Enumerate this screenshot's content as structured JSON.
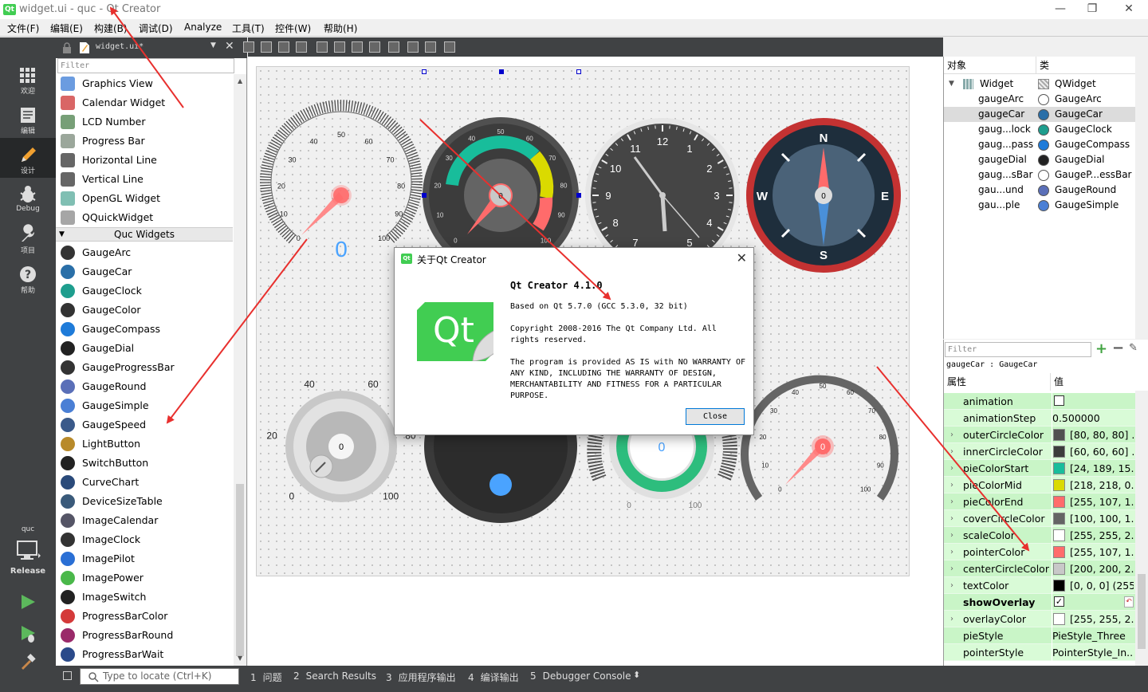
{
  "window": {
    "title": "widget.ui - quc - Qt Creator",
    "minimize": "—",
    "restore": "❐",
    "close": "✕"
  },
  "menu": [
    "文件(F)",
    "编辑(E)",
    "构建(B)",
    "调试(D)",
    "Analyze",
    "工具(T)",
    "控件(W)",
    "帮助(H)"
  ],
  "modes": [
    {
      "label": "欢迎",
      "icon": "grid-icon"
    },
    {
      "label": "编辑",
      "icon": "edit-icon"
    },
    {
      "label": "设计",
      "icon": "pencil-icon"
    },
    {
      "label": "Debug",
      "icon": "bug-icon"
    },
    {
      "label": "项目",
      "icon": "wrench-icon"
    },
    {
      "label": "帮助",
      "icon": "help-icon"
    }
  ],
  "kit": {
    "project": "quc",
    "config": "Release"
  },
  "editor_tab": {
    "filename": "widget.ui*"
  },
  "widget_box": {
    "filter_placeholder": "Filter",
    "items_top": [
      "Graphics View",
      "Calendar Widget",
      "LCD Number",
      "Progress Bar",
      "Horizontal Line",
      "Vertical Line",
      "OpenGL Widget",
      "QQuickWidget"
    ],
    "category": "Quc Widgets",
    "items_quc": [
      "GaugeArc",
      "GaugeCar",
      "GaugeClock",
      "GaugeColor",
      "GaugeCompass",
      "GaugeDial",
      "GaugeProgressBar",
      "GaugeRound",
      "GaugeSimple",
      "GaugeSpeed",
      "LightButton",
      "SwitchButton",
      "CurveChart",
      "DeviceSizeTable",
      "ImageCalendar",
      "ImageClock",
      "ImagePilot",
      "ImagePower",
      "ImageSwitch",
      "ProgressBarColor",
      "ProgressBarRound",
      "ProgressBarWait"
    ]
  },
  "canvas": {
    "gauge_arc": {
      "ticks": [
        "0",
        "10",
        "20",
        "30",
        "40",
        "50",
        "60",
        "70",
        "80",
        "90",
        "100"
      ],
      "value": "0"
    },
    "gauge_car": {
      "ticks": [
        "0",
        "10",
        "20",
        "30",
        "40",
        "50",
        "60",
        "70",
        "80",
        "90",
        "100"
      ],
      "value": "0"
    },
    "gauge_clock": {
      "ticks": [
        "12",
        "1",
        "2",
        "3",
        "4",
        "5",
        "7",
        "8",
        "9",
        "10",
        "11"
      ]
    },
    "gauge_compass": {
      "n": "N",
      "e": "E",
      "s": "S",
      "w": "W",
      "value": "0"
    },
    "gauge_dial": {
      "ticks": [
        "0",
        "20",
        "40",
        "60",
        "80",
        "100"
      ],
      "value": "0"
    },
    "gauge_round": {
      "value": "0",
      "min": "0",
      "max": "100"
    },
    "gauge_simple": {
      "ticks": [
        "0",
        "10",
        "20",
        "30",
        "40",
        "50",
        "60",
        "70",
        "80",
        "90",
        "100"
      ],
      "value": "0"
    }
  },
  "about_dialog": {
    "title": "关于Qt Creator",
    "heading": "Qt Creator 4.1.0",
    "based_on": "Based on Qt 5.7.0 (GCC 5.3.0, 32 bit)",
    "copyright": "Copyright 2008-2016 The Qt Company Ltd. All rights reserved.",
    "warranty": "The program is provided AS IS with NO WARRANTY OF ANY KIND, INCLUDING THE WARRANTY OF DESIGN, MERCHANTABILITY AND FITNESS FOR A PARTICULAR PURPOSE.",
    "logo_text": "Qt",
    "close_button": "Close"
  },
  "object_inspector": {
    "col_object": "对象",
    "col_class": "类",
    "root": {
      "name": "Widget",
      "cls": "QWidget"
    },
    "rows": [
      {
        "name": "gaugeArc",
        "cls": "GaugeArc"
      },
      {
        "name": "gaugeCar",
        "cls": "GaugeCar"
      },
      {
        "name": "gaug...lock",
        "cls": "GaugeClock"
      },
      {
        "name": "gaug...pass",
        "cls": "GaugeCompass"
      },
      {
        "name": "gaugeDial",
        "cls": "GaugeDial"
      },
      {
        "name": "gaug...sBar",
        "cls": "GaugeP...essBar"
      },
      {
        "name": "gau...und",
        "cls": "GaugeRound"
      },
      {
        "name": "gau...ple",
        "cls": "GaugeSimple"
      }
    ],
    "selected_index": 1
  },
  "property_editor": {
    "filter_placeholder": "Filter",
    "object_class": "gaugeCar : GaugeCar",
    "col_property": "属性",
    "col_value": "值",
    "rows": [
      {
        "name": "animation",
        "type": "check",
        "checked": false,
        "expand": false
      },
      {
        "name": "animationStep",
        "type": "text",
        "value": "0.500000",
        "expand": false
      },
      {
        "name": "outerCircleColor",
        "type": "color",
        "color": "#505050",
        "value": "[80, 80, 80] ...",
        "expand": true
      },
      {
        "name": "innerCircleColor",
        "type": "color",
        "color": "#3c3c3c",
        "value": "[60, 60, 60] ...",
        "expand": true
      },
      {
        "name": "pieColorStart",
        "type": "color",
        "color": "#18bd9b",
        "value": "[24, 189, 15...",
        "expand": true
      },
      {
        "name": "pieColorMid",
        "type": "color",
        "color": "#dada00",
        "value": "[218, 218, 0...",
        "expand": true
      },
      {
        "name": "pieColorEnd",
        "type": "color",
        "color": "#ff6b6b",
        "value": "[255, 107, 1...",
        "expand": true
      },
      {
        "name": "coverCircleColor",
        "type": "color",
        "color": "#646464",
        "value": "[100, 100, 1...",
        "expand": true
      },
      {
        "name": "scaleColor",
        "type": "color",
        "color": "#ffffff",
        "value": "[255, 255, 2...",
        "expand": true
      },
      {
        "name": "pointerColor",
        "type": "color",
        "color": "#ff6b6b",
        "value": "[255, 107, 1...",
        "expand": true
      },
      {
        "name": "centerCircleColor",
        "type": "color",
        "color": "#c8c8c8",
        "value": "[200, 200, 2...",
        "expand": true
      },
      {
        "name": "textColor",
        "type": "color",
        "color": "#000000",
        "value": "[0, 0, 0] (255)",
        "expand": true
      },
      {
        "name": "showOverlay",
        "type": "check",
        "checked": true,
        "expand": false,
        "bold": true
      },
      {
        "name": "overlayColor",
        "type": "color",
        "color": "#ffffff",
        "value": "[255, 255, 2...",
        "expand": true
      },
      {
        "name": "pieStyle",
        "type": "text",
        "value": "PieStyle_Three",
        "expand": false
      },
      {
        "name": "pointerStyle",
        "type": "text",
        "value": "PointerStyle_In...",
        "expand": false
      }
    ]
  },
  "output_bar": {
    "locate_placeholder": "Type to locate (Ctrl+K)",
    "tabs": [
      {
        "num": "1",
        "label": "问题"
      },
      {
        "num": "2",
        "label": "Search Results"
      },
      {
        "num": "3",
        "label": "应用程序输出"
      },
      {
        "num": "4",
        "label": "编译输出"
      },
      {
        "num": "5",
        "label": "Debugger Console"
      }
    ]
  },
  "colors": {
    "qt_green": "#41cd52",
    "annotation_red": "#e8302e",
    "property_green": "#c9f5c7",
    "dark_chrome": "#404244"
  }
}
